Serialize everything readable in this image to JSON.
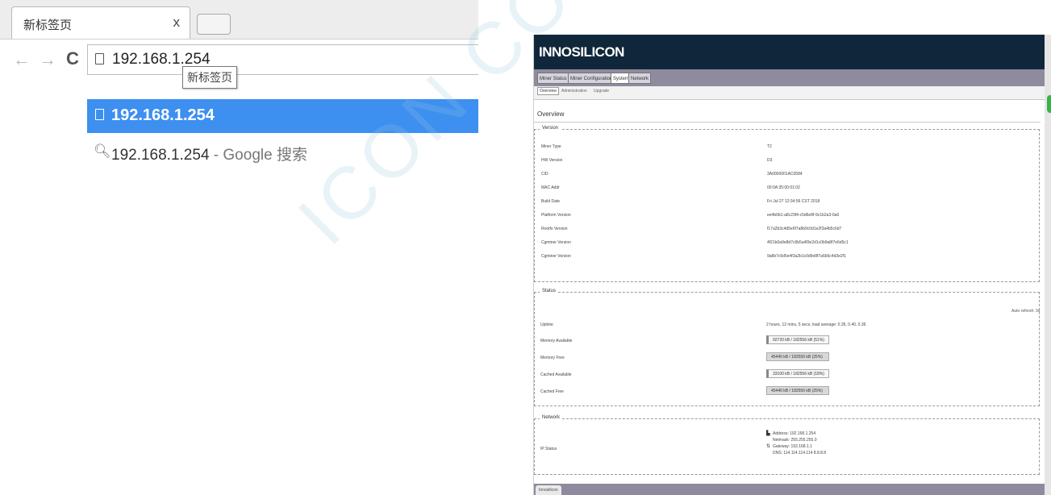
{
  "browser": {
    "tab_title": "新标签页",
    "tab_close": "x",
    "address_value": "192.168.1.254",
    "tooltip": "新标签页",
    "suggestions": [
      {
        "text": "192.168.1.254"
      },
      {
        "text": "192.168.1.254",
        "suffix": " - Google 搜索"
      }
    ]
  },
  "app": {
    "brand": "INNOSILICON",
    "main_tabs": [
      "Miner Status",
      "Miner Configuration",
      "System",
      "Network"
    ],
    "sub_tabs": [
      "Overview",
      "Administration",
      "Upgrade"
    ],
    "page_title": "Overview",
    "version_section": {
      "title": "Version",
      "rows": [
        {
          "label": "Miner Type",
          "value": "T2"
        },
        {
          "label": "HW Version",
          "value": "D3"
        },
        {
          "label": "CID",
          "value": "3A0000001AC0584"
        },
        {
          "label": "MAC Addr",
          "value": "00:0A:35:00:01:02"
        },
        {
          "label": "Build Date",
          "value": "Fri Jul 27 12:34:56 CST 2018"
        },
        {
          "label": "Platform Version",
          "value": "ee4b0b1-a8c23f4-c5d6e8f-9c1b2a3-0a6"
        },
        {
          "label": "Rootfs Version",
          "value": "f17a2b3c4d5e6f7a8b9c0d1e2f3a4b5c6d7"
        },
        {
          "label": "Cgminer Version",
          "value": "4f21b0a9e8d7c6b5a4f3e2d1c0b9a8f7e6d5c1"
        },
        {
          "label": "Cgminer Version",
          "value": "9a8b7c6d5e4f3a2b1c0d9e8f7a6b5c4d3e2f1"
        }
      ]
    },
    "status_section": {
      "title": "Status",
      "autorefresh": "Auto refresh: 3s",
      "rows": [
        {
          "label": "Uptime",
          "value": "2 hours, 12 mins, 5 secs, load average: 0.35, 0.40, 0.36"
        },
        {
          "label": "Memory Available",
          "value": "92720 kB / 182556 kB (51%)"
        },
        {
          "label": "Memory Free",
          "value": "45440 kB / 182556 kB (25%)"
        },
        {
          "label": "Cached Available",
          "value": "33100 kB / 182556 kB (18%)"
        },
        {
          "label": "Cached Free",
          "value": "45440 kB / 182556 kB (25%)"
        }
      ]
    },
    "network_section": {
      "title": "Network",
      "ip_label": "IP Status",
      "lines": [
        "Address: 192.168.1.254",
        "Netmask: 255.255.255.0",
        "Gateway: 192.168.1.1",
        "DNS: 114.114.114.114 8.8.8.8"
      ]
    },
    "footer_tab": "Innosilicon"
  },
  "watermark": "ICON CONFIDENTIAL"
}
